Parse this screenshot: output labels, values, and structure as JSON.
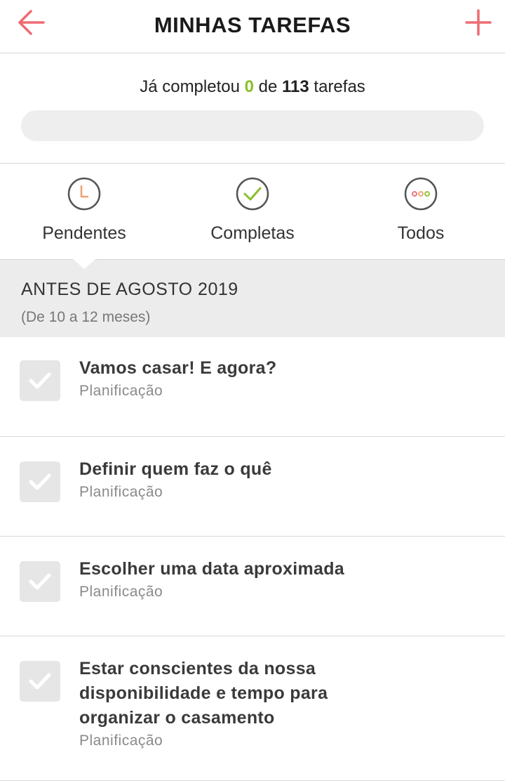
{
  "header": {
    "title": "MINHAS TAREFAS",
    "back_icon": "arrow-left-icon",
    "add_icon": "plus-icon",
    "accent_color": "#ee6b73"
  },
  "progress": {
    "prefix": "Já completou",
    "completed": "0",
    "middle": "de",
    "total": "113",
    "suffix": "tarefas",
    "fraction": 0,
    "color": "#8cbf2a"
  },
  "filters": [
    {
      "label": "Pendentes",
      "icon": "clock-icon"
    },
    {
      "label": "Completas",
      "icon": "check-circle-icon"
    },
    {
      "label": "Todos",
      "icon": "dots-circle-icon"
    }
  ],
  "section": {
    "title": "ANTES DE AGOSTO 2019",
    "subtitle": "(De 10 a 12 meses)"
  },
  "tasks": [
    {
      "name": "Vamos casar! E agora?",
      "category": "Planificação"
    },
    {
      "name": "Definir quem faz o quê",
      "category": "Planificação"
    },
    {
      "name": "Escolher uma data aproximada",
      "category": "Planificação"
    },
    {
      "name": "Estar conscientes da nossa disponibilidade e tempo para organizar o casamento",
      "category": "Planificação"
    }
  ]
}
